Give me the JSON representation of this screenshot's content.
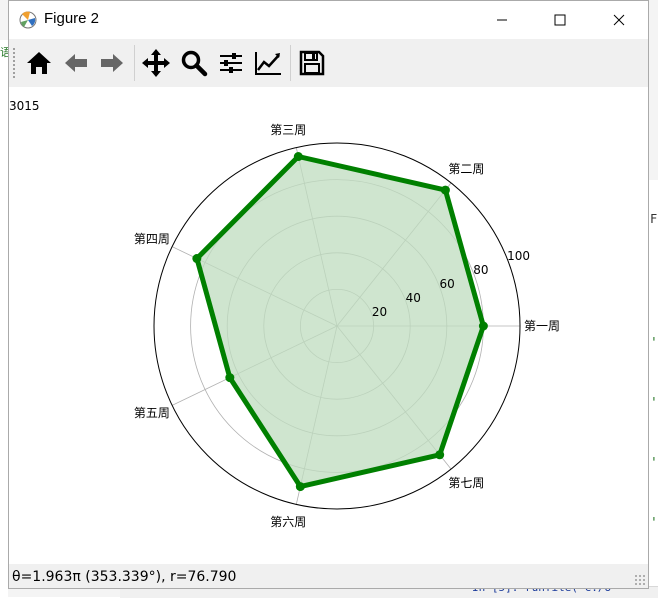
{
  "window": {
    "title": "Figure 2"
  },
  "background": {
    "fragments": [
      "语",
      "F",
      "'/(",
      "'/(",
      "'/(",
      "'/(",
      "In [5]: runfile('C:/U"
    ]
  },
  "toolbar": {
    "items": [
      {
        "name": "home-icon"
      },
      {
        "name": "back-arrow-icon"
      },
      {
        "name": "forward-arrow-icon"
      },
      {
        "name": "pan-move-icon"
      },
      {
        "name": "zoom-magnifier-icon"
      },
      {
        "name": "subplots-config-icon"
      },
      {
        "name": "edit-axes-icon"
      },
      {
        "name": "save-floppy-icon"
      }
    ]
  },
  "canvas": {
    "corner_text": "3015"
  },
  "status": {
    "text": "θ=1.963π (353.339°), r=76.790"
  },
  "chart_data": {
    "type": "radar",
    "categories": [
      "第一周",
      "第二周",
      "第三周",
      "第四周",
      "第五周",
      "第六周",
      "第七周"
    ],
    "values": [
      80,
      95,
      95,
      85,
      65,
      90,
      90
    ],
    "rlim": [
      0,
      100
    ],
    "rticks": [
      20,
      40,
      60,
      80,
      100
    ],
    "grid": true,
    "line_color": "#008000",
    "fill_color": "#bfdcbf"
  }
}
